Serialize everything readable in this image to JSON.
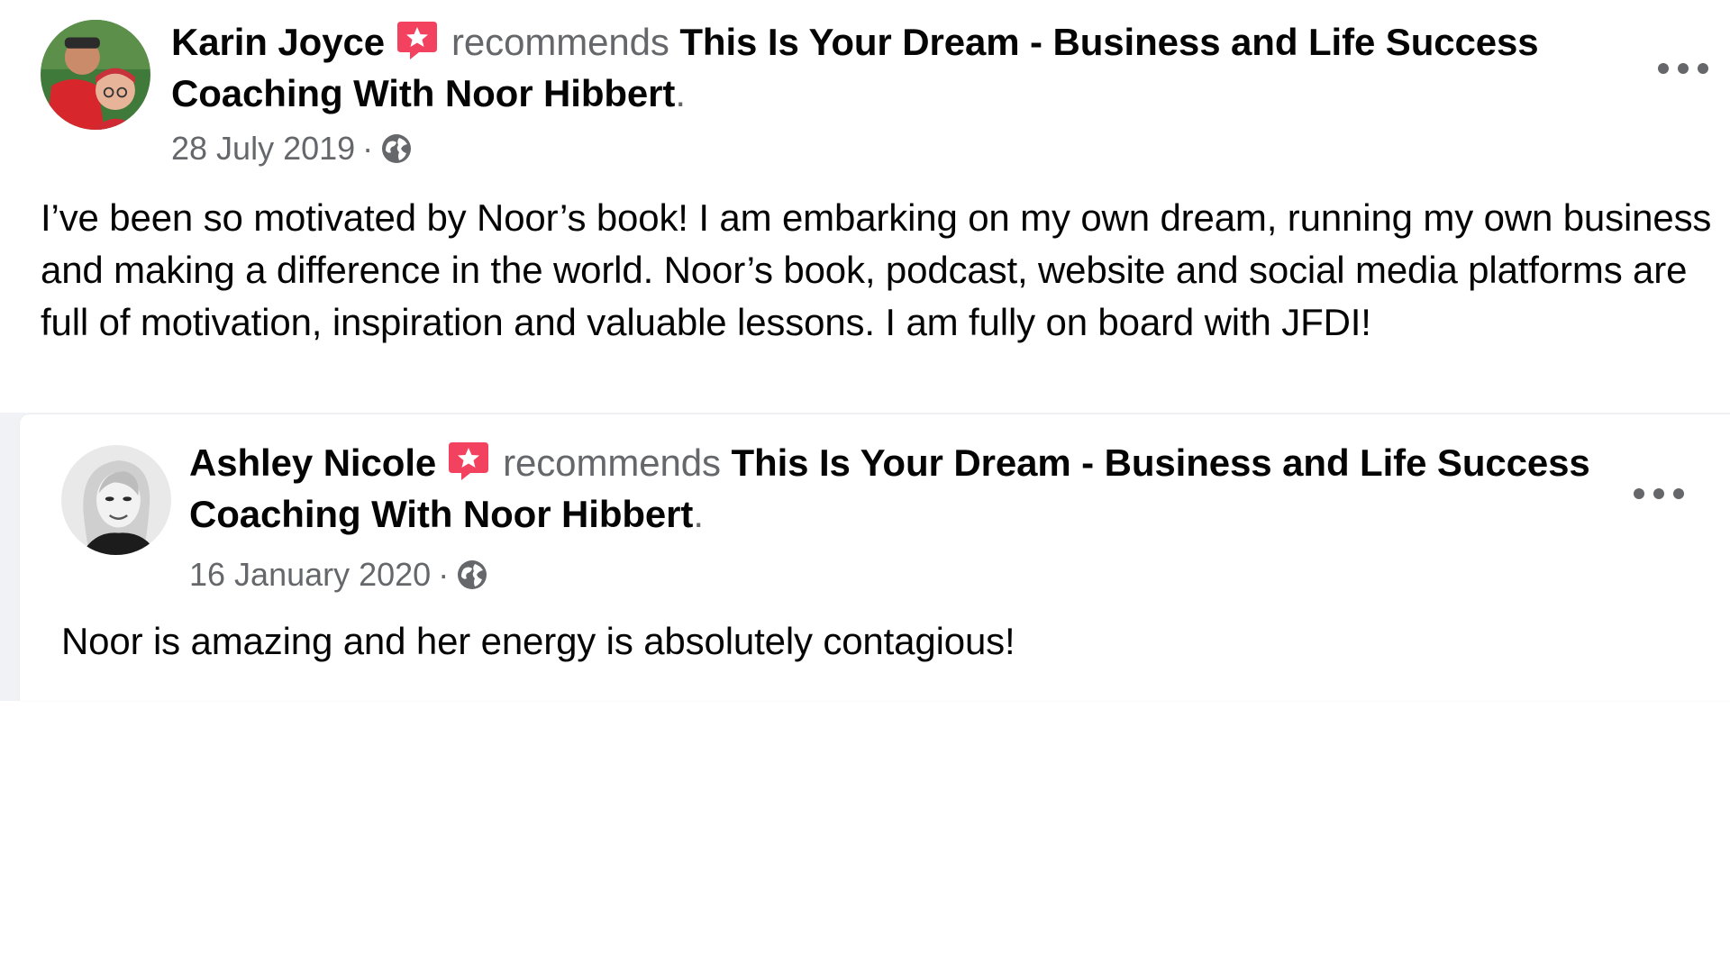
{
  "posts": [
    {
      "author": "Karin Joyce",
      "verb": "recommends",
      "page": "This Is Your Dream - Business and Life Success Coaching With Noor Hibbert",
      "suffix": ".",
      "date": "28 July 2019",
      "separator": " · ",
      "privacy_icon": "globe-icon",
      "more_icon": "more-options-icon",
      "text": "I’ve been so motivated by Noor’s book! I am embarking on my own dream, running my own business and making a difference in the world. Noor’s book, podcast, website and social media platforms are full of motivation, inspiration and valuable lessons. I am fully on board with JFDI!"
    },
    {
      "author": "Ashley Nicole",
      "verb": "recommends",
      "page": "This Is Your Dream - Business and Life Success Coaching With Noor Hibbert",
      "suffix": ".",
      "date": "16 January 2020",
      "separator": " · ",
      "privacy_icon": "globe-icon",
      "more_icon": "more-options-icon",
      "text": "Noor is amazing and her energy is absolutely contagious!"
    }
  ],
  "colors": {
    "text_primary": "#050505",
    "text_secondary": "#65676b",
    "recommend_badge": "#f3425f",
    "page_background": "#f0f2f5"
  }
}
